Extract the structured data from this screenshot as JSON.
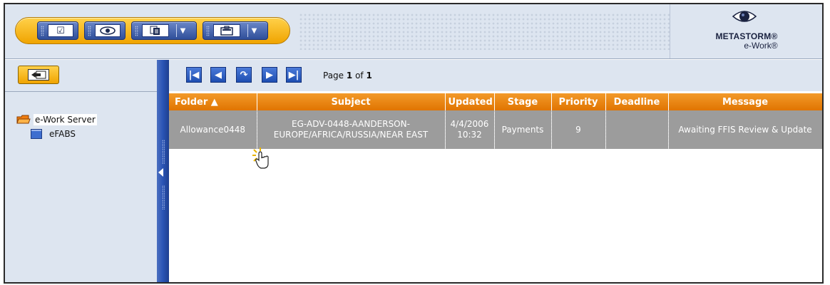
{
  "toolbar": {
    "icons": [
      "checkbox-icon",
      "eye-icon",
      "copy-icon",
      "chevron-down-icon",
      "briefcase-icon",
      "chevron-down-icon"
    ]
  },
  "logo": {
    "brand": "METASTORM®",
    "product": "e-Work®"
  },
  "tree": {
    "root": {
      "label": "e-Work Server",
      "icon": "folder-open-icon"
    },
    "children": [
      {
        "label": "eFABS",
        "icon": "database-icon"
      }
    ]
  },
  "pager": {
    "page_label": "Page",
    "current_page": "1",
    "of_label": "of",
    "total_pages": "1",
    "buttons": [
      "first-page",
      "previous-page",
      "refresh",
      "next-page",
      "last-page"
    ]
  },
  "table": {
    "columns": [
      "Folder ▲",
      "Subject",
      "Updated",
      "Stage",
      "Priority",
      "Deadline",
      "Message"
    ],
    "rows": [
      {
        "folder": "Allowance0448",
        "subject": "EG-ADV-0448-AANDERSON-EUROPE/AFRICA/RUSSIA/NEAR EAST",
        "updated": "4/4/2006 10:32",
        "stage": "Payments",
        "priority": "9",
        "deadline": "",
        "message": "Awaiting FFIS Review & Update"
      }
    ]
  },
  "colors": {
    "accent_orange": "#f08a10",
    "toolbar_blue": "#2f4f9a",
    "pane_bg": "#dde5f0",
    "selected_row": "#9c9c9c"
  }
}
